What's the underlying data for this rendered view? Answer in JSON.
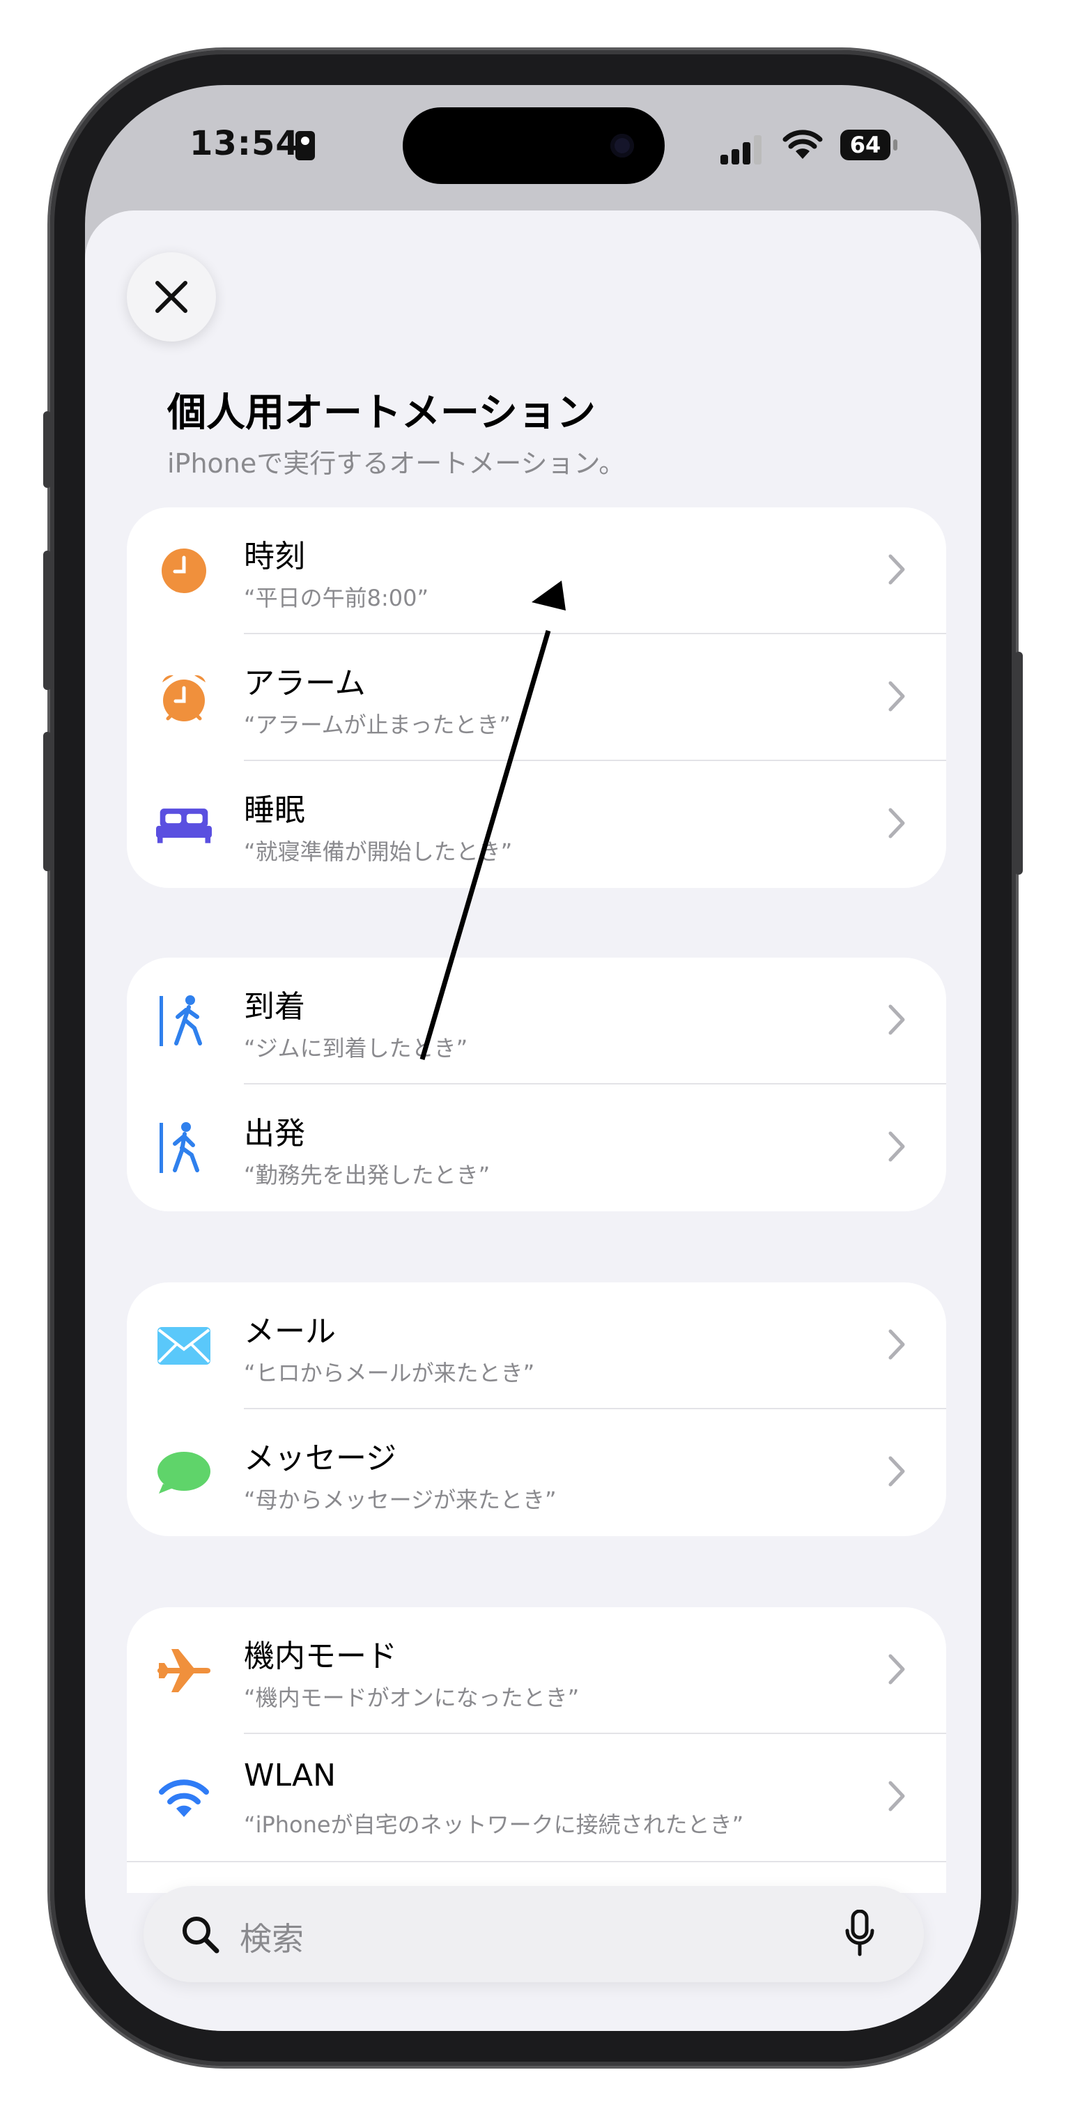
{
  "status_bar": {
    "time": "13:54",
    "battery": "64"
  },
  "sheet": {
    "title": "個人用オートメーション",
    "subtitle": "iPhoneで実行するオートメーション。"
  },
  "groups": [
    {
      "rows": [
        {
          "icon": "clock-icon",
          "title": "時刻",
          "subtitle": "“平日の午前8:00”"
        },
        {
          "icon": "alarm-icon",
          "title": "アラーム",
          "subtitle": "“アラームが止まったとき”"
        },
        {
          "icon": "bed-icon",
          "title": "睡眠",
          "subtitle": "“就寝準備が開始したとき”"
        }
      ]
    },
    {
      "rows": [
        {
          "icon": "walk-arrive-icon",
          "title": "到着",
          "subtitle": "“ジムに到着したとき”"
        },
        {
          "icon": "walk-leave-icon",
          "title": "出発",
          "subtitle": "“勤務先を出発したとき”"
        }
      ]
    },
    {
      "rows": [
        {
          "icon": "mail-icon",
          "title": "メール",
          "subtitle": "“ヒロからメールが来たとき”"
        },
        {
          "icon": "message-icon",
          "title": "メッセージ",
          "subtitle": "“母からメッセージが来たとき”"
        }
      ]
    },
    {
      "rows": [
        {
          "icon": "airplane-icon",
          "title": "機内モード",
          "subtitle": "“機内モードがオンになったとき”"
        },
        {
          "icon": "wifi-icon",
          "title": "WLAN",
          "subtitle": "“iPhoneが自宅のネットワークに接続されたとき”"
        }
      ]
    }
  ],
  "search": {
    "placeholder": "検索"
  },
  "colors": {
    "clock": "#f0903c",
    "bed": "#5a4fe0",
    "walk": "#2f80ed",
    "mail": "#5ac8fa",
    "message": "#5fd46a",
    "airplane": "#f0903c",
    "wifi": "#2f7cf6",
    "annotation_arrow": "#000000"
  }
}
